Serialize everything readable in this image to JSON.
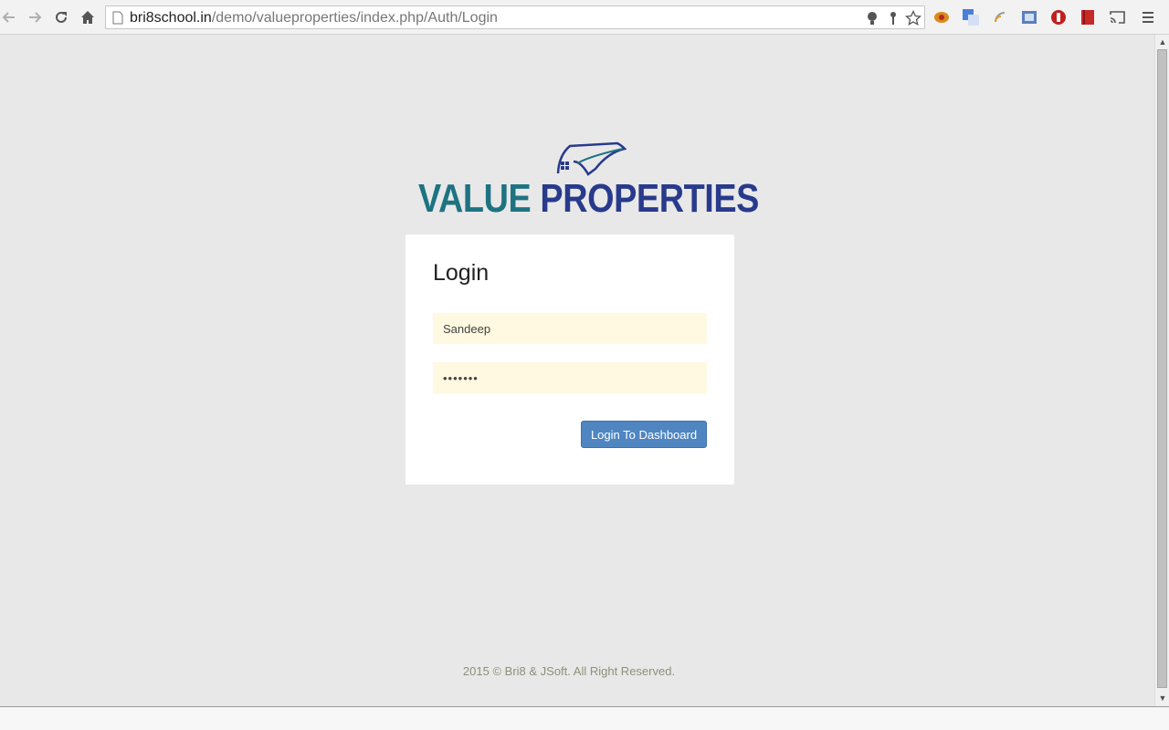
{
  "browser": {
    "url_host": "bri8school.in",
    "url_path": "/demo/valueproperties/index.php/Auth/Login"
  },
  "logo": {
    "word1": "VALUE",
    "word2": "PROPERTIES",
    "teal": "#1e7382",
    "navy": "#283a8c"
  },
  "login": {
    "title": "Login",
    "username_value": "Sandeep",
    "password_value": "•••••••",
    "submit_label": "Login To Dashboard"
  },
  "footer": {
    "text": "2015 © Bri8 & JSoft. All Right Reserved."
  },
  "colors": {
    "page_bg": "#e8e8e8",
    "button": "#4f86c2",
    "autofill": "#fef9e0"
  }
}
